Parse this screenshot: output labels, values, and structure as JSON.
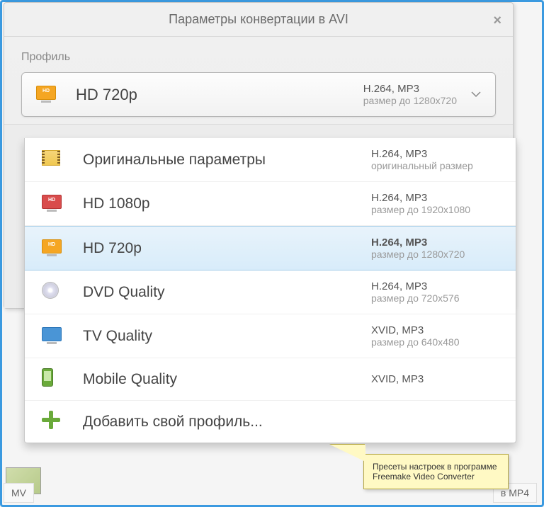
{
  "dialog": {
    "title": "Параметры конвертации в AVI",
    "section_label": "Профиль"
  },
  "selected": {
    "name": "HD 720p",
    "codecs": "H.264, MP3",
    "size": "размер до 1280x720",
    "icon_type": "monitor-orange"
  },
  "options": [
    {
      "name": "Оригинальные параметры",
      "codecs": "H.264, MP3",
      "size": "оригинальный размер",
      "icon": "film",
      "highlighted": false
    },
    {
      "name": "HD 1080p",
      "codecs": "H.264, MP3",
      "size": "размер до 1920x1080",
      "icon": "monitor-red",
      "highlighted": false
    },
    {
      "name": "HD 720p",
      "codecs": "H.264, MP3",
      "size": "размер до 1280x720",
      "icon": "monitor-orange",
      "highlighted": true
    },
    {
      "name": "DVD Quality",
      "codecs": "H.264, MP3",
      "size": "размер до 720x576",
      "icon": "disc",
      "highlighted": false
    },
    {
      "name": "TV Quality",
      "codecs": "XVID, MP3",
      "size": "размер до 640x480",
      "icon": "monitor-blue",
      "highlighted": false
    },
    {
      "name": "Mobile Quality",
      "codecs": "XVID, MP3",
      "size": "",
      "icon": "phone",
      "highlighted": false
    }
  ],
  "add_profile": "Добавить свой профиль...",
  "callout": "Пресеты настроек в программе Freemake Video Converter",
  "bottom": {
    "left": "MV",
    "right": "в MP4"
  }
}
